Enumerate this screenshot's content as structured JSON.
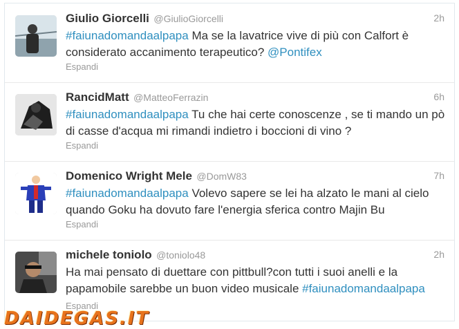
{
  "tweets": [
    {
      "name": "Giulio Giorcelli",
      "handle": "@GiulioGiorcelli",
      "time": "2h",
      "hashtag": "#faiunadomandaalpapa",
      "text": " Ma se la lavatrice vive di più con Calfort è considerato accanimento terapeutico? ",
      "mention": "@Pontifex",
      "expand": "Espandi"
    },
    {
      "name": "RancidMatt",
      "handle": "@MatteoFerrazin",
      "time": "6h",
      "hashtag": "#faiunadomandaalpapa",
      "text": " Tu che hai certe conoscenze , se ti mando un pò di casse d'acqua mi rimandi indietro i boccioni di vino ?",
      "expand": "Espandi"
    },
    {
      "name": "Domenico Wright Mele",
      "handle": "@DomW83",
      "time": "7h",
      "hashtag": "#faiunadomandaalpapa",
      "text": " Volevo sapere se lei ha alzato le mani al cielo quando Goku ha dovuto fare l'energia sferica contro Majin Bu",
      "expand": "Espandi"
    },
    {
      "name": "michele toniolo",
      "handle": "@toniolo48",
      "time": "2h",
      "text": "Ha mai pensato di duettare con pittbull?con tutti i suoi anelli e la papamobile sarebbe un buon video musicale ",
      "hashtag": "#faiunadomandaalpapa",
      "expand": "Espandi"
    }
  ],
  "watermark": "DAIDEGAS.IT",
  "colors": {
    "link": "#2f8fbf",
    "meta": "#999999",
    "text": "#333333",
    "watermark": "#e8731c"
  }
}
